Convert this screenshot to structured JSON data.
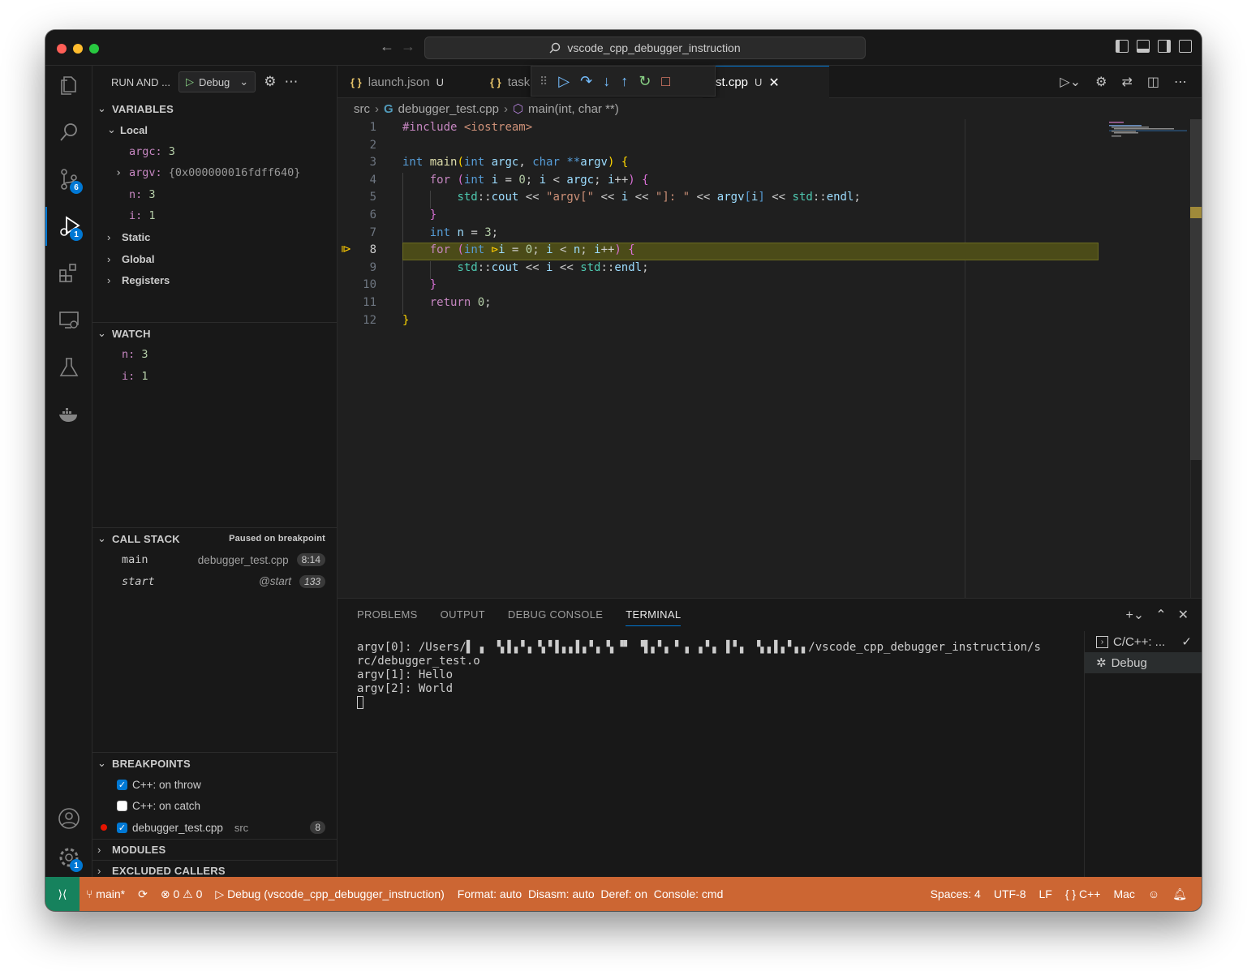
{
  "titlebar": {
    "search_text": "vscode_cpp_debugger_instruction"
  },
  "activity": {
    "scm_badge": "6",
    "debug_badge": "1",
    "settings_badge": "1"
  },
  "sidebar": {
    "header": "RUN AND ...",
    "config": "Debug",
    "variables": {
      "title": "VARIABLES",
      "local_label": "Local",
      "locals": [
        {
          "name": "argc:",
          "value": "3"
        },
        {
          "name": "argv:",
          "value": "{0x000000016fdff640}"
        },
        {
          "name": "n:",
          "value": "3"
        },
        {
          "name": "i:",
          "value": "1"
        }
      ],
      "scopes": [
        "Static",
        "Global",
        "Registers"
      ]
    },
    "watch": {
      "title": "WATCH",
      "items": [
        {
          "name": "n:",
          "value": "3"
        },
        {
          "name": "i:",
          "value": "1"
        }
      ]
    },
    "callstack": {
      "title": "CALL STACK",
      "status": "Paused on breakpoint",
      "frames": [
        {
          "name": "main",
          "file": "debugger_test.cpp",
          "line": "8:14"
        },
        {
          "name": "start",
          "file": "@start",
          "line": "133"
        }
      ]
    },
    "breakpoints": {
      "title": "BREAKPOINTS",
      "items": [
        {
          "label": "C++: on throw",
          "checked": true
        },
        {
          "label": "C++: on catch",
          "checked": false
        },
        {
          "label": "debugger_test.cpp",
          "dir": "src",
          "count": "8",
          "checked": true
        }
      ]
    },
    "modules_title": "MODULES",
    "excluded_title": "EXCLUDED CALLERS"
  },
  "tabs": [
    {
      "label": "launch.json",
      "status": "U"
    },
    {
      "label": "task",
      "status": ""
    },
    {
      "label": "st.cpp",
      "status": "U"
    }
  ],
  "breadcrumb": {
    "folder": "src",
    "file": "debugger_test.cpp",
    "symbol": "main(int, char **)"
  },
  "editor": {
    "line_numbers": [
      "1",
      "2",
      "3",
      "4",
      "5",
      "6",
      "7",
      "8",
      "9",
      "10",
      "11",
      "12"
    ],
    "current_line": 8
  },
  "panel": {
    "tabs": [
      "PROBLEMS",
      "OUTPUT",
      "DEBUG CONSOLE",
      "TERMINAL"
    ],
    "terminal_lines": [
      "argv[0]: /Users/▌ ▖ ▝▖▌▖▘▖▝▖▘▌▖▖▌▖▘▖▝▖▝▘ ▝▌▖▘▖▝ ▖ ▖▘▖ ▌▘▖ ▝▖▖▌▖▘▖▖/vscode_cpp_debugger_instruction/s",
      "rc/debugger_test.o",
      "argv[1]: Hello",
      "argv[2]: World"
    ],
    "terminals": [
      "C/C++: ...",
      "Debug"
    ]
  },
  "statusbar": {
    "branch": "main*",
    "errors": "0",
    "warnings": "0",
    "debug": "Debug (vscode_cpp_debugger_instruction)",
    "info": "Format: auto  Disasm: auto  Deref: on  Console: cmd",
    "spaces": "Spaces: 4",
    "encoding": "UTF-8",
    "eol": "LF",
    "lang": "C++",
    "platform": "Mac"
  },
  "colors": {
    "accent": "#0078d4",
    "status": "#cc6633",
    "remote": "#16825d",
    "current_line": "#4b4b18"
  }
}
